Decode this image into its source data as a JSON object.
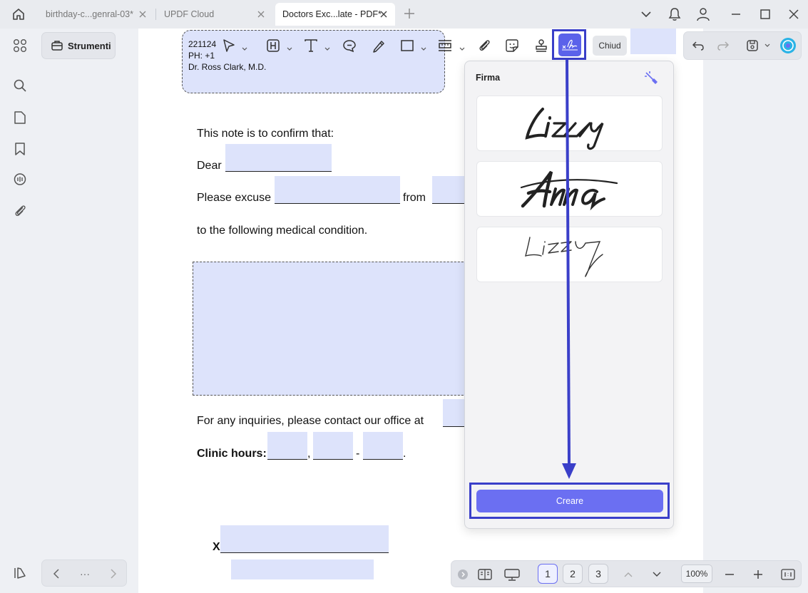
{
  "tabs": [
    {
      "label": "birthday-c...genral-03*",
      "active": false
    },
    {
      "label": "UPDF Cloud",
      "active": false
    },
    {
      "label": "Doctors Exc...late - PDF*",
      "active": true
    }
  ],
  "tools_panel": {
    "strumenti_label": "Strumenti",
    "pager_more": "···"
  },
  "document": {
    "header_lines": [
      "221124",
      "PH: +1",
      "Dr. Ross Clark, M.D."
    ],
    "confirm_line": "This note is to confirm that:",
    "dear": "Dear",
    "please_excuse": "Please excuse",
    "from": "from",
    "condition_line": "to the following medical condition.",
    "inquiries": "For any inquiries, please contact our office at",
    "clinic_hours": "Clinic hours:",
    "comma": ",",
    "dash": "-",
    "period": ".",
    "x_mark": "X"
  },
  "toolbar": {
    "close_label": "Chiud"
  },
  "signature_panel": {
    "title": "Firma",
    "signatures": [
      "Lizzy",
      "Anna",
      "Lizzy"
    ],
    "create_label": "Creare"
  },
  "bottom": {
    "pages": [
      "1",
      "2",
      "3"
    ],
    "current_page": "1",
    "zoom": "100%"
  },
  "colors": {
    "accent": "#6b6ff2",
    "highlight": "#3a3fc9",
    "field_fill": "#dde3fb"
  }
}
